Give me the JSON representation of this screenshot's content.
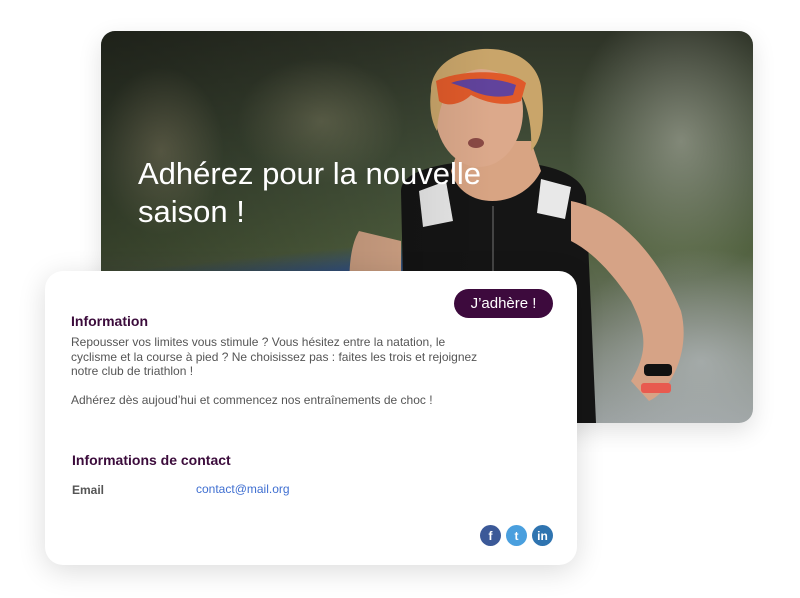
{
  "hero": {
    "title": "Adhérez pour la nouvelle saison !",
    "image": "triathlete-runner-photo"
  },
  "card": {
    "join_button": "J’adhère !",
    "information": {
      "title": "Information",
      "paragraph1": "Repousser vos limites vous stimule ? Vous hésitez entre la natation, le cyclisme et la course à pied ? Ne choisissez pas : faites les trois et rejoignez notre club de triathlon !",
      "paragraph2": "Adhérez dès aujoud’hui et commencez nos entraînements de choc !"
    },
    "contact": {
      "title": "Informations de contact",
      "email_label": "Email",
      "email_value": "contact@mail.org"
    },
    "socials": [
      {
        "icon": "facebook-icon",
        "glyph": "f",
        "color": "#3b5998"
      },
      {
        "icon": "twitter-icon",
        "glyph": "t",
        "color": "#4a9fde"
      },
      {
        "icon": "linkedin-icon",
        "glyph": "in",
        "color": "#2f74b0"
      }
    ]
  },
  "colors": {
    "accent": "#3d0a3d",
    "heading": "#3b0b3b",
    "link": "#3f6fd1"
  }
}
